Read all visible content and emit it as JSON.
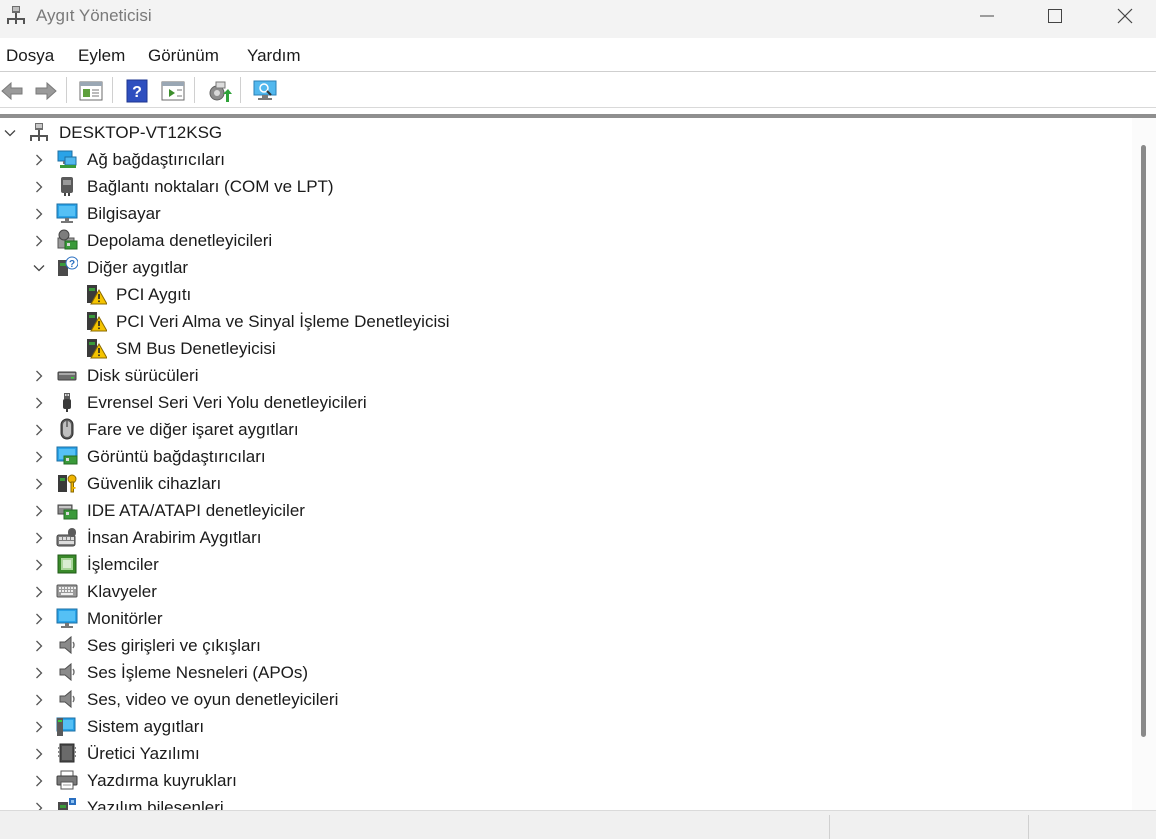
{
  "window": {
    "title": "Aygıt Yöneticisi"
  },
  "menu": [
    {
      "label": "Dosya"
    },
    {
      "label": "Eylem"
    },
    {
      "label": "Görünüm"
    },
    {
      "label": "Yardım"
    }
  ],
  "toolbar": {
    "buttons": [
      "back-arrow-icon",
      "forward-arrow-icon",
      "properties-icon",
      "help-icon",
      "show-hide-icon",
      "update-driver-icon",
      "scan-hardware-icon"
    ]
  },
  "tree": {
    "root": {
      "label": "DESKTOP-VT12KSG",
      "icon": "computer-network-icon",
      "expanded": true
    },
    "categories": [
      {
        "label": "Ağ bağdaştırıcıları",
        "icon": "network-adapter-icon",
        "expanded": false
      },
      {
        "label": "Bağlantı noktaları (COM ve LPT)",
        "icon": "port-icon",
        "expanded": false
      },
      {
        "label": "Bilgisayar",
        "icon": "monitor-icon",
        "expanded": false
      },
      {
        "label": "Depolama denetleyicileri",
        "icon": "storage-controller-icon",
        "expanded": false
      },
      {
        "label": "Diğer aygıtlar",
        "icon": "unknown-device-icon",
        "expanded": true,
        "children": [
          {
            "label": "PCI Aygıtı",
            "icon": "warning-device-icon"
          },
          {
            "label": "PCI Veri Alma ve Sinyal İşleme Denetleyicisi",
            "icon": "warning-device-icon"
          },
          {
            "label": "SM Bus Denetleyicisi",
            "icon": "warning-device-icon"
          }
        ]
      },
      {
        "label": "Disk sürücüleri",
        "icon": "disk-drive-icon",
        "expanded": false
      },
      {
        "label": "Evrensel Seri Veri Yolu denetleyicileri",
        "icon": "usb-icon",
        "expanded": false
      },
      {
        "label": "Fare ve diğer işaret aygıtları",
        "icon": "mouse-icon",
        "expanded": false
      },
      {
        "label": "Görüntü bağdaştırıcıları",
        "icon": "display-adapter-icon",
        "expanded": false
      },
      {
        "label": "Güvenlik cihazları",
        "icon": "security-key-icon",
        "expanded": false
      },
      {
        "label": "IDE ATA/ATAPI denetleyiciler",
        "icon": "ide-controller-icon",
        "expanded": false
      },
      {
        "label": "İnsan Arabirim Aygıtları",
        "icon": "hid-icon",
        "expanded": false
      },
      {
        "label": "İşlemciler",
        "icon": "processor-icon",
        "expanded": false
      },
      {
        "label": "Klavyeler",
        "icon": "keyboard-icon",
        "expanded": false
      },
      {
        "label": "Monitörler",
        "icon": "monitor-icon",
        "expanded": false
      },
      {
        "label": "Ses girişleri ve çıkışları",
        "icon": "speaker-icon",
        "expanded": false
      },
      {
        "label": "Ses İşleme Nesneleri (APOs)",
        "icon": "speaker-icon",
        "expanded": false
      },
      {
        "label": "Ses, video ve oyun denetleyicileri",
        "icon": "speaker-icon",
        "expanded": false
      },
      {
        "label": "Sistem aygıtları",
        "icon": "system-device-icon",
        "expanded": false
      },
      {
        "label": "Üretici Yazılımı",
        "icon": "firmware-icon",
        "expanded": false
      },
      {
        "label": "Yazdırma kuyrukları",
        "icon": "printer-icon",
        "expanded": false
      },
      {
        "label": "Yazılım bileşenleri",
        "icon": "software-component-icon",
        "expanded": false
      }
    ]
  },
  "colors": {
    "accent": "#0078d4",
    "warning": "#f5c400",
    "monitor": "#2aa3e8"
  }
}
